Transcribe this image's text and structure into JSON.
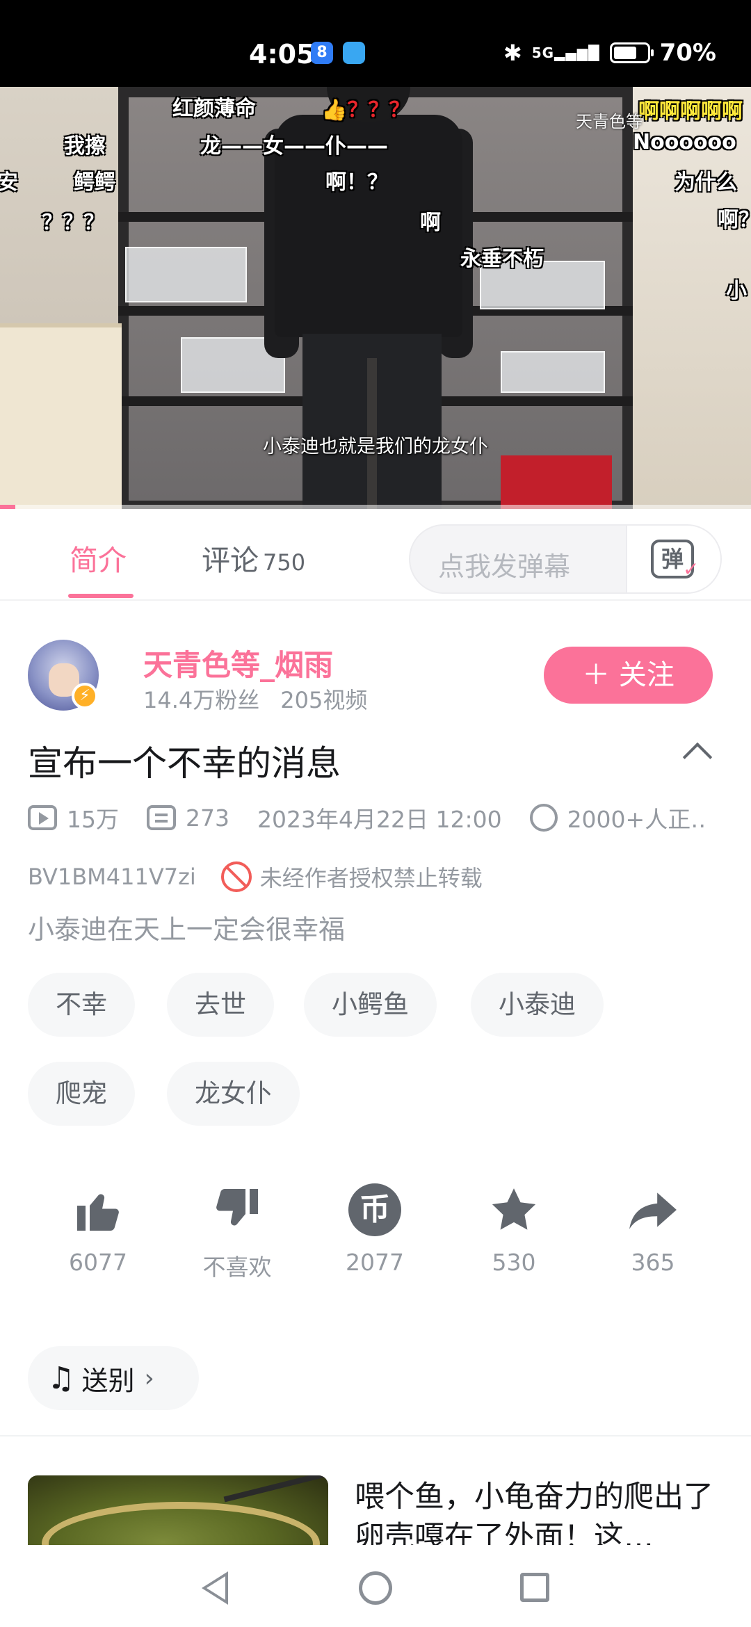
{
  "status_bar": {
    "time": "4:05",
    "app_badge": "8",
    "network": "5G",
    "battery_percent": "70%",
    "battery_level": 0.7
  },
  "video": {
    "subtitle": "小泰迪也就是我们的龙女仆",
    "danmaku": {
      "d1": "红颜薄命",
      "d2_icons": "👍",
      "d2_marks": "？？？",
      "d3": "龙——女——仆——",
      "d4": "啊！？",
      "d5": "啊",
      "d6": "永垂不朽",
      "d7": "我擦",
      "d8": "鳄鳄",
      "d9": "？？？",
      "d10": "安",
      "d11": "啊啊啊啊啊",
      "d12": "Noooooo",
      "d13": "为什么",
      "d14": "啊？",
      "d15": "小",
      "d16": "天青色等"
    },
    "progress": 0.02
  },
  "tabs": {
    "intro_label": "简介",
    "comments_label": "评论",
    "comments_count": "750",
    "danmaku_placeholder": "点我发弹幕",
    "danmaku_button_glyph": "弹"
  },
  "uploader": {
    "name": "天青色等_烟雨",
    "fans": "14.4万粉丝",
    "videos": "205视频",
    "follow_label": "＋ 关注"
  },
  "video_info": {
    "title": "宣布一个不幸的消息",
    "views": "15万",
    "danmaku_count": "273",
    "publish_time": "2023年4月22日 12:00",
    "watching": "2000+人正‥",
    "bvid": "BV1BM411V7zi",
    "copyright_notice": "未经作者授权禁止转载",
    "description": "小泰迪在天上一定会很幸福"
  },
  "tags": [
    "不幸",
    "去世",
    "小鳄鱼",
    "小泰迪",
    "爬宠",
    "龙女仆"
  ],
  "actions": {
    "like": "6077",
    "dislike": "不喜欢",
    "coin": "2077",
    "coin_glyph": "币",
    "favorite": "530",
    "share": "365"
  },
  "music": {
    "label": "送别"
  },
  "recommendation": {
    "title": "喂个鱼，小龟奋力的爬出了卵壳嘎在了外面！这…"
  },
  "colors": {
    "accent": "#fb7299",
    "text_primary": "#18191c",
    "text_secondary": "#9499a0"
  }
}
